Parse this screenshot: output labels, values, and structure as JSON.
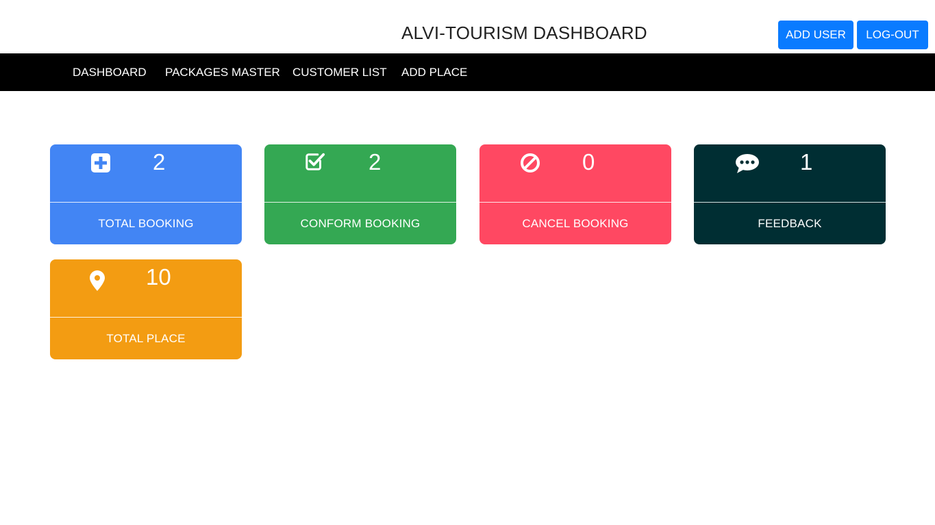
{
  "header": {
    "title": "ALVI-TOURISM DASHBOARD",
    "add_user_label": "ADD USER",
    "logout_label": "LOG-OUT"
  },
  "nav": {
    "items": [
      {
        "label": "DASHBOARD"
      },
      {
        "label": "PACKAGES MASTER"
      },
      {
        "label": "CUSTOMER LIST"
      },
      {
        "label": "ADD PLACE"
      }
    ]
  },
  "cards": [
    {
      "label": "TOTAL BOOKING",
      "count": "2",
      "icon": "plus-square-icon",
      "color": "#4285f4"
    },
    {
      "label": "CONFORM BOOKING",
      "count": "2",
      "icon": "check-square-icon",
      "color": "#34a853"
    },
    {
      "label": "CANCEL BOOKING",
      "count": "0",
      "icon": "ban-icon",
      "color": "#ff4862"
    },
    {
      "label": "FEEDBACK",
      "count": "1",
      "icon": "comment-dots-icon",
      "color": "#002e33"
    },
    {
      "label": "TOTAL PLACE",
      "count": "10",
      "icon": "map-marker-icon",
      "color": "#f39c12"
    }
  ],
  "colors": {
    "navbar": "#000000",
    "button": "#0a7bff"
  }
}
